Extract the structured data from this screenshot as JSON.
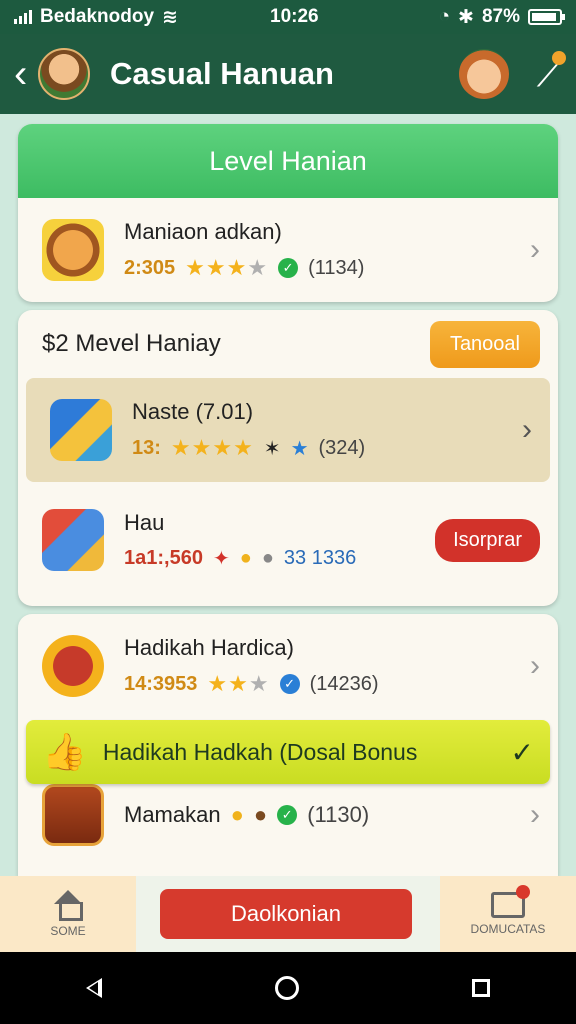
{
  "status_bar": {
    "carrier": "Bedaknodoy",
    "time": "10:26",
    "battery": "87%"
  },
  "app_bar": {
    "title": "Casual Hanuan"
  },
  "section1": {
    "header": "Level Hanian",
    "item": {
      "title": "Maniaon adkan)",
      "price": "2:305",
      "count": "(1134)"
    }
  },
  "section2": {
    "title": "$2 Mevel Haniay",
    "action_label": "Tanooal",
    "items": [
      {
        "title": "Naste (7.01)",
        "price": "13:",
        "count": "(324)"
      },
      {
        "title": "Hau",
        "price": "1a1:,560",
        "count": "33 1336",
        "action_label": "Isorprar"
      }
    ]
  },
  "section3": {
    "items": [
      {
        "title": "Hadikah Hardica)",
        "price": "14:3953",
        "count": "(14236)"
      },
      {
        "title": "Mamakan",
        "count": "(1130)"
      }
    ],
    "bonus": "Hadikah Hadkah (Dosal Bonus"
  },
  "bottom_nav": {
    "home_label": "SOME",
    "cta_label": "Daolkonian",
    "right_label": "DOMUCATAS"
  },
  "colors": {
    "primary": "#1f5a40",
    "accent": "#3dbc62",
    "cta": "#d63a2d",
    "bonus": "#d3e22c"
  }
}
